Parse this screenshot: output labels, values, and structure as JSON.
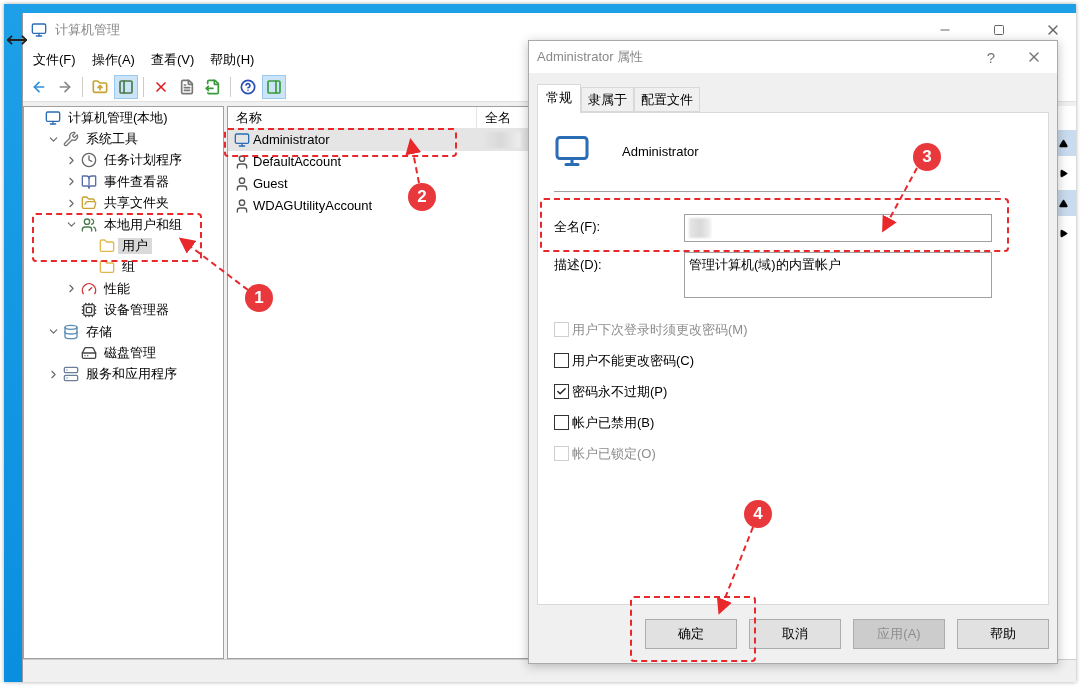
{
  "main_window": {
    "title": "计算机管理",
    "menu": [
      "文件(F)",
      "操作(A)",
      "查看(V)",
      "帮助(H)"
    ],
    "toolbar": [
      {
        "kind": "back",
        "pressed": false
      },
      {
        "kind": "forward",
        "pressed": false
      },
      {
        "kind": "up",
        "pressed": false
      },
      {
        "kind": "tree-toggle",
        "pressed": true
      },
      {
        "kind": "delete",
        "pressed": false
      },
      {
        "kind": "properties",
        "pressed": false
      },
      {
        "kind": "export",
        "pressed": false
      },
      {
        "kind": "help",
        "pressed": false
      },
      {
        "kind": "action-toggle",
        "pressed": true
      }
    ],
    "tree": [
      {
        "label": "计算机管理(本地)",
        "kind": "computer",
        "selected": false,
        "children": [
          {
            "label": "系统工具",
            "kind": "tools",
            "expanded": true,
            "selected": false,
            "children": [
              {
                "label": "任务计划程序",
                "kind": "clock",
                "expanded": false,
                "selected": false
              },
              {
                "label": "事件查看器",
                "kind": "log",
                "expanded": false,
                "selected": false
              },
              {
                "label": "共享文件夹",
                "kind": "share",
                "expanded": false,
                "selected": false
              },
              {
                "label": "本地用户和组",
                "kind": "users",
                "expanded": true,
                "selected": false,
                "children": [
                  {
                    "label": "用户",
                    "kind": "folder",
                    "selected": true
                  },
                  {
                    "label": "组",
                    "kind": "folder",
                    "selected": false
                  }
                ]
              },
              {
                "label": "性能",
                "kind": "gauge",
                "expanded": false,
                "selected": false
              },
              {
                "label": "设备管理器",
                "kind": "device",
                "selected": false
              }
            ]
          },
          {
            "label": "存储",
            "kind": "storage",
            "expanded": true,
            "selected": false,
            "children": [
              {
                "label": "磁盘管理",
                "kind": "disk",
                "selected": false
              }
            ]
          },
          {
            "label": "服务和应用程序",
            "kind": "server",
            "expanded": false,
            "selected": false
          }
        ]
      }
    ],
    "list": {
      "columns": [
        "名称",
        "全名"
      ],
      "rows": [
        {
          "name": "Administrator",
          "kind": "admin",
          "selected": true,
          "blurred_full_name": true
        },
        {
          "name": "DefaultAccount",
          "kind": "user",
          "selected": false,
          "blurred_full_name": false
        },
        {
          "name": "Guest",
          "kind": "user",
          "selected": false,
          "blurred_full_name": false
        },
        {
          "name": "WDAGUtilityAccount",
          "kind": "user",
          "selected": false,
          "blurred_full_name": false
        }
      ]
    }
  },
  "dialog": {
    "title": "Administrator 属性",
    "help": "?",
    "tabs": [
      {
        "label": "常规",
        "selected": true
      },
      {
        "label": "隶属于",
        "selected": false
      },
      {
        "label": "配置文件",
        "selected": false
      }
    ],
    "account_name": "Administrator",
    "fields": [
      {
        "label": "全名(F):",
        "blurred": true,
        "multiline": false
      },
      {
        "label": "描述(D):",
        "value": "管理计算机(域)的内置帐户",
        "blurred": false,
        "multiline": true
      }
    ],
    "checkboxes": [
      {
        "label": "用户下次登录时须更改密码(M)",
        "checked": false,
        "disabled": true
      },
      {
        "label": "用户不能更改密码(C)",
        "checked": false,
        "disabled": false
      },
      {
        "label": "密码永不过期(P)",
        "checked": true,
        "disabled": false
      },
      {
        "label": "帐户已禁用(B)",
        "checked": false,
        "disabled": false
      },
      {
        "label": "帐户已锁定(O)",
        "checked": false,
        "disabled": true
      }
    ],
    "buttons": [
      {
        "label": "确定",
        "disabled": false
      },
      {
        "label": "取消",
        "disabled": false
      },
      {
        "label": "应用(A)",
        "disabled": true
      },
      {
        "label": "帮助",
        "disabled": false
      }
    ]
  },
  "annotations": [
    "1",
    "2",
    "3",
    "4"
  ]
}
